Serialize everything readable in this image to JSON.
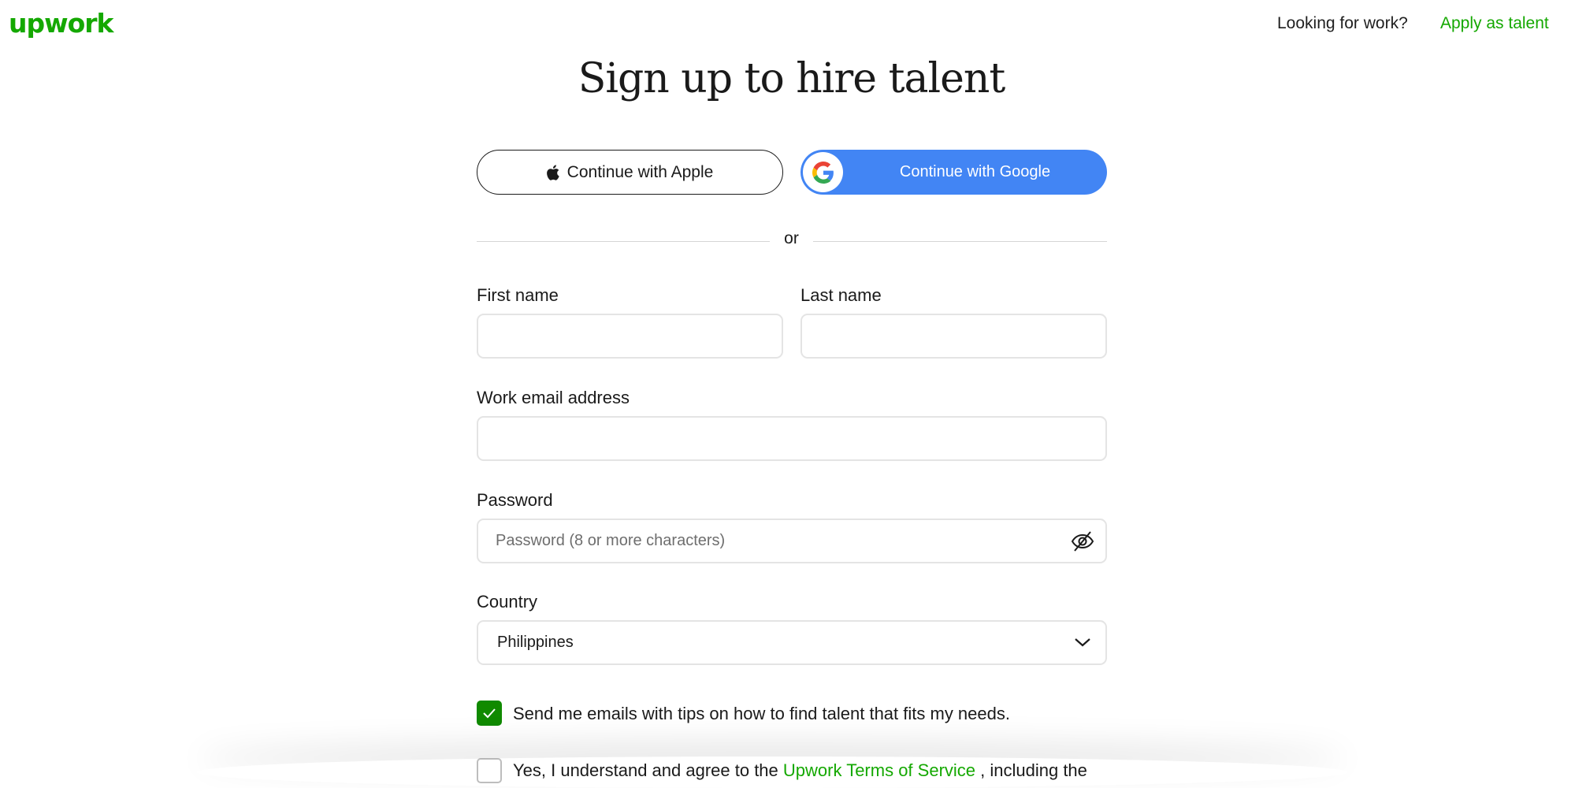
{
  "header": {
    "logo_text": "upwork",
    "nav_question": "Looking for work?",
    "nav_apply": "Apply as talent"
  },
  "page_title": "Sign up to hire talent",
  "sso": {
    "apple_label": "Continue with Apple",
    "google_label": "Continue with Google"
  },
  "divider_text": "or",
  "form": {
    "first_name": {
      "label": "First name",
      "value": ""
    },
    "last_name": {
      "label": "Last name",
      "value": ""
    },
    "email": {
      "label": "Work email address",
      "value": ""
    },
    "password": {
      "label": "Password",
      "value": "",
      "placeholder": "Password (8 or more characters)"
    },
    "country": {
      "label": "Country",
      "selected": "Philippines"
    }
  },
  "checks": {
    "emails_label": "Send me emails with tips on how to find talent that fits my needs.",
    "emails_checked": true,
    "terms_prefix": "Yes, I understand and agree to the",
    "terms_link": "Upwork Terms of Service",
    "terms_suffix": ", including the",
    "terms_checked": false
  },
  "icons": {
    "apple": "apple-icon",
    "google": "google-icon",
    "eye": "eye-slash-icon",
    "chevron": "chevron-down-icon",
    "check": "check-icon"
  },
  "colors": {
    "brand": "#14a800",
    "google_blue": "#4285f4",
    "checkbox_green": "#108a00"
  }
}
